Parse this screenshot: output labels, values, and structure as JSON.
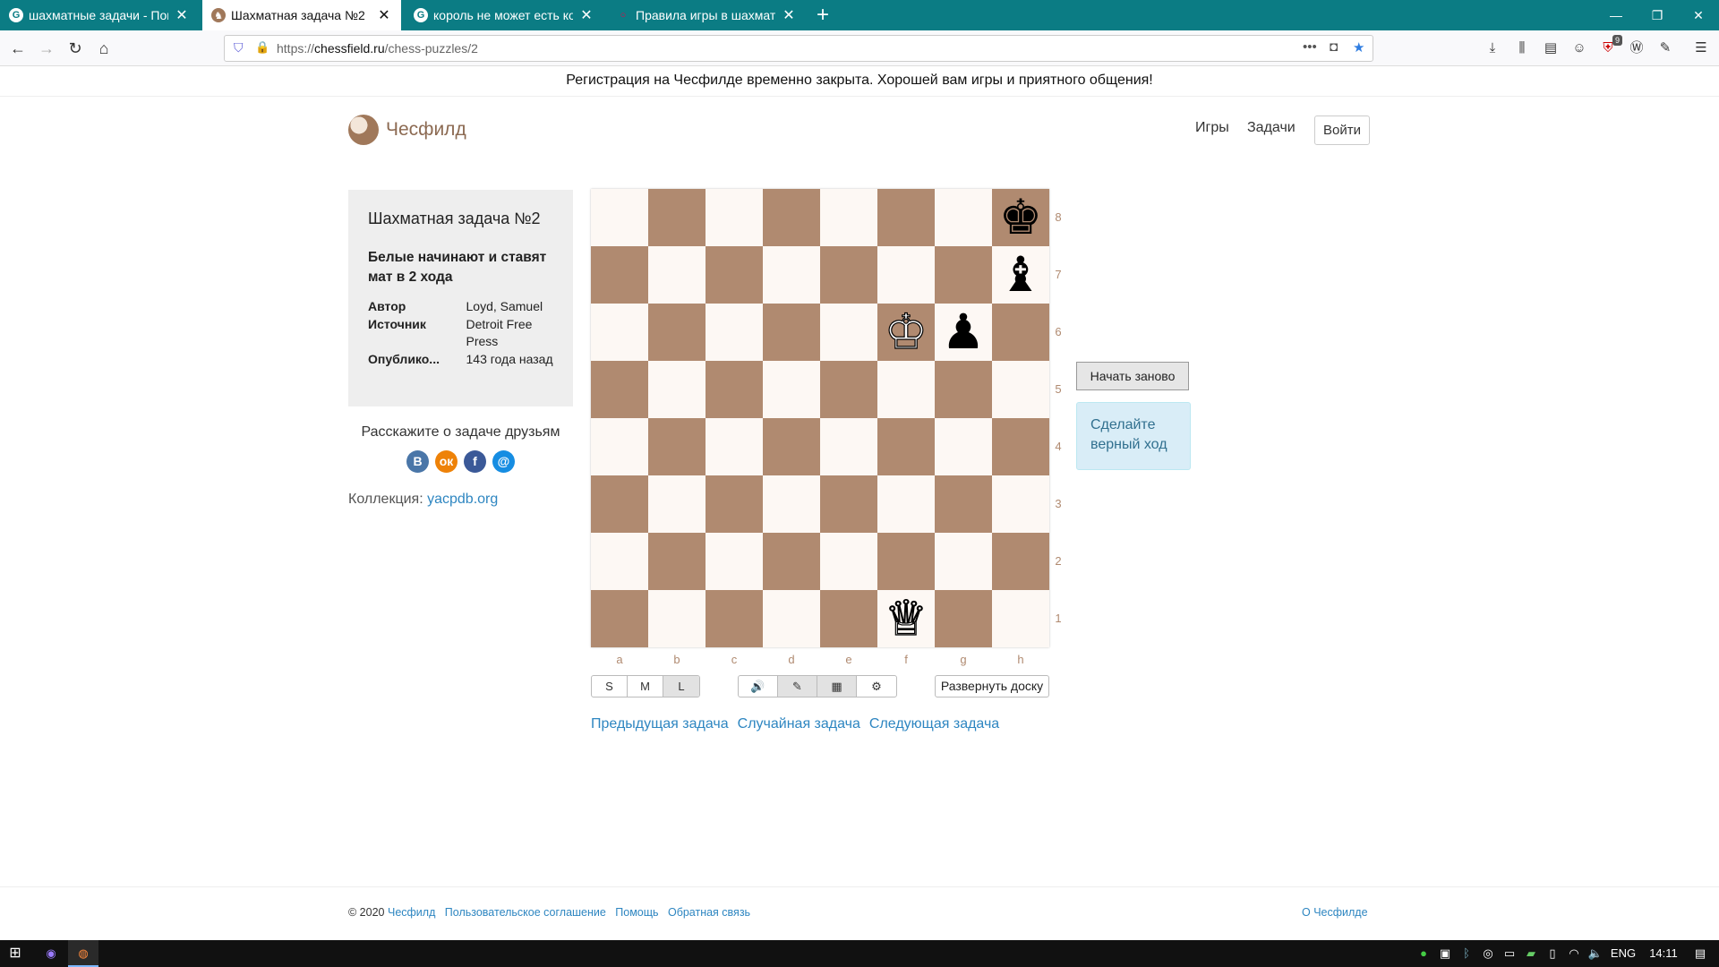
{
  "browser": {
    "tabs": [
      {
        "label": "шахматные задачи - Поиск в",
        "favicon": "G"
      },
      {
        "label": "Шахматная задача №2",
        "favicon": "♞"
      },
      {
        "label": "король не может есть король",
        "favicon": "G"
      },
      {
        "label": "Правила игры в шахматы",
        "favicon": "○"
      }
    ],
    "url_prefix": "https://",
    "url_domain": "chessfield.ru",
    "url_path": "/chess-puzzles/2",
    "extension_badge": "9"
  },
  "announcement": "Регистрация на Чесфилде временно закрыта. Хорошей вам игры и приятного общения!",
  "header": {
    "site_name": "Чесфилд",
    "nav_games": "Игры",
    "nav_puzzles": "Задачи",
    "login_label": "Войти"
  },
  "puzzle": {
    "title": "Шахматная задача №2",
    "task": "Белые начинают и ставят мат в 2 хода",
    "meta": [
      {
        "key": "Автор",
        "value": "Loyd, Samuel"
      },
      {
        "key": "Источник",
        "value": "Detroit Free Press"
      },
      {
        "key": "Опублико...",
        "value": "143 года назад"
      }
    ]
  },
  "share": {
    "title": "Расскажите о задаче друзьям",
    "icons": [
      {
        "name": "vk-icon",
        "glyph": "В",
        "color": "#4a76a8"
      },
      {
        "name": "odnoklassniki-icon",
        "glyph": "ок",
        "color": "#ee8208"
      },
      {
        "name": "facebook-icon",
        "glyph": "f",
        "color": "#3b5998"
      },
      {
        "name": "mailru-icon",
        "glyph": "@",
        "color": "#168de2"
      }
    ]
  },
  "collection": {
    "label": "Коллекция:",
    "link": "yacpdb.org"
  },
  "board": {
    "files": [
      "a",
      "b",
      "c",
      "d",
      "e",
      "f",
      "g",
      "h"
    ],
    "ranks": [
      "8",
      "7",
      "6",
      "5",
      "4",
      "3",
      "2",
      "1"
    ],
    "light_color": "#fdf8f4",
    "dark_color": "#b08a70",
    "pieces": [
      {
        "square": "h8",
        "glyph": "♚",
        "color": "black",
        "name": "black-king"
      },
      {
        "square": "h7",
        "glyph": "♝",
        "color": "black",
        "name": "black-bishop"
      },
      {
        "square": "f6",
        "glyph": "♔",
        "color": "white",
        "name": "white-king"
      },
      {
        "square": "g6",
        "glyph": "♟",
        "color": "black",
        "name": "black-pawn"
      },
      {
        "square": "f1",
        "glyph": "♕",
        "color": "white",
        "name": "white-queen"
      }
    ]
  },
  "controls": {
    "sizes": [
      "S",
      "M",
      "L"
    ],
    "selected_size": "L",
    "tool_icons": [
      "🔊",
      "✎",
      "▦",
      "⚙"
    ],
    "flip_label": "Развернуть доску",
    "restart_label": "Начать заново",
    "status": "Сделайте верный ход"
  },
  "puzzle_nav": {
    "prev": "Предыдущая задача",
    "random": "Случайная задача",
    "next": "Следующая задача"
  },
  "footer": {
    "copyright": "© 2020",
    "site": "Чесфилд",
    "agreement": "Пользовательское соглашение",
    "help": "Помощь",
    "feedback": "Обратная связь",
    "about": "О Чесфилде"
  },
  "taskbar": {
    "lang": "ENG",
    "time": "14:11"
  }
}
